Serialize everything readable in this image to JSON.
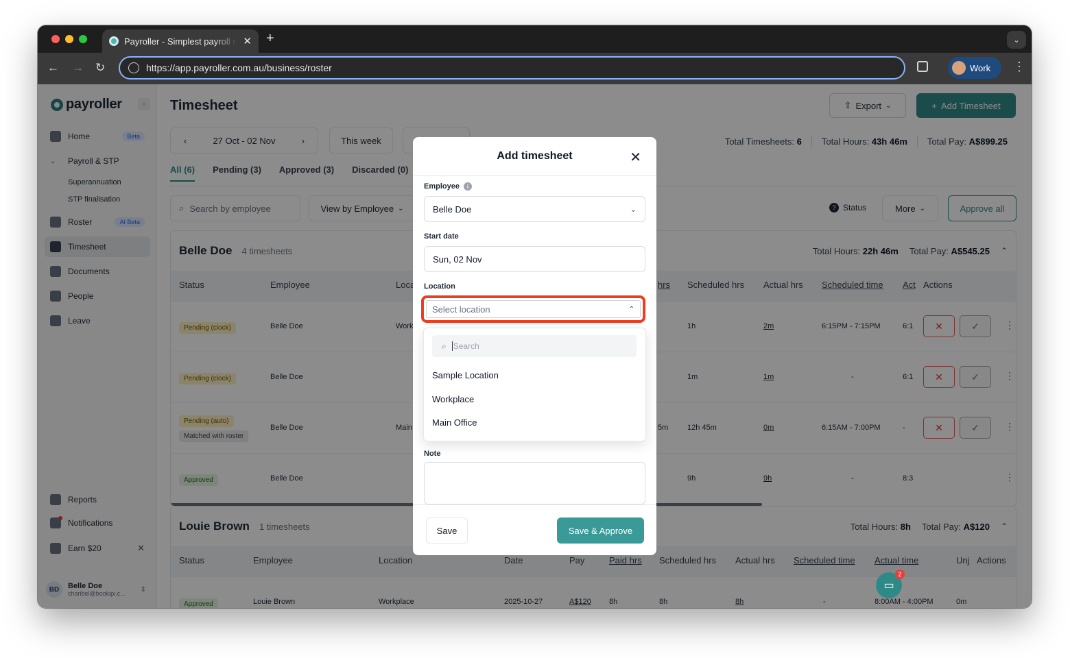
{
  "browser": {
    "tab_title": "Payroller - Simplest payroll software",
    "url": "https://app.payroller.com.au/business/roster",
    "profile_label": "Work"
  },
  "sidebar": {
    "logo": "payroller",
    "items": [
      {
        "label": "Home",
        "badge": "Beta"
      },
      {
        "label": "Payroll & STP"
      },
      {
        "label": "Superannuation"
      },
      {
        "label": "STP finalisation"
      },
      {
        "label": "Roster",
        "badge": "AI Beta"
      },
      {
        "label": "Timesheet"
      },
      {
        "label": "Documents"
      },
      {
        "label": "People"
      },
      {
        "label": "Leave"
      },
      {
        "label": "Reports"
      },
      {
        "label": "Notifications"
      },
      {
        "label": "Earn $20"
      }
    ],
    "user": {
      "initials": "BD",
      "name": "Belle Doe",
      "email": "charibel@bookipi.c..."
    }
  },
  "main": {
    "title": "Timesheet",
    "export_label": "Export",
    "add_label": "Add Timesheet",
    "date_range": "27 Oct - 02 Nov",
    "this_week": "This week",
    "totals": {
      "timesheets_label": "Total Timesheets:",
      "timesheets": "6",
      "hours_label": "Total Hours:",
      "hours": "43h 46m",
      "pay_label": "Total Pay:",
      "pay": "A$899.25"
    },
    "tabs": [
      "All (6)",
      "Pending (3)",
      "Approved (3)",
      "Discarded (0)"
    ],
    "search_placeholder": "Search by employee",
    "view_by": "View by Employee",
    "status_label": "Status",
    "more_label": "More",
    "approve_all": "Approve all"
  },
  "group1": {
    "name": "Belle Doe",
    "count": "4 timesheets",
    "hours_label": "Total Hours:",
    "hours": "22h 46m",
    "pay_label": "Total Pay:",
    "pay": "A$545.25",
    "headers": [
      "Status",
      "Employee",
      "Loca",
      "hrs",
      "Scheduled hrs",
      "Actual hrs",
      "Scheduled time",
      "Act",
      "Actions"
    ],
    "rows": [
      {
        "status": "Pending (clock)",
        "employee": "Belle Doe",
        "location": "Work",
        "scheduled": "1h",
        "actual": "2m",
        "time": "6:15PM - 7:15PM",
        "act": "6:1"
      },
      {
        "status": "Pending (clock)",
        "employee": "Belle Doe",
        "location": "",
        "scheduled": "1m",
        "actual": "1m",
        "time": "-",
        "act": "6:1"
      },
      {
        "status": "Pending (auto)",
        "status2": "Matched with roster",
        "employee": "Belle Doe",
        "location": "Main",
        "paid": "5m",
        "scheduled": "12h 45m",
        "actual": "0m",
        "time": "6:15AM - 7:00PM",
        "act": "-"
      },
      {
        "status": "Approved",
        "employee": "Belle Doe",
        "location": "",
        "scheduled": "9h",
        "actual": "9h",
        "time": "-",
        "act": "8:3"
      }
    ]
  },
  "group2": {
    "name": "Louie Brown",
    "count": "1 timesheets",
    "hours_label": "Total Hours:",
    "hours": "8h",
    "pay_label": "Total Pay:",
    "pay": "A$120",
    "headers": [
      "Status",
      "Employee",
      "Location",
      "Date",
      "Pay",
      "Paid hrs",
      "Scheduled hrs",
      "Actual hrs",
      "Scheduled time",
      "Actual time",
      "Unj",
      "Actions"
    ],
    "row": {
      "status": "Approved",
      "employee": "Louie Brown",
      "location": "Workplace",
      "date": "2025-10-27",
      "pay": "A$120",
      "paid": "8h",
      "scheduled": "8h",
      "actual": "8h",
      "stime": "-",
      "atime": "8:00AM - 4:00PM",
      "unj": "0m"
    }
  },
  "chat_badge": "2",
  "modal": {
    "title": "Add timesheet",
    "employee_label": "Employee",
    "employee_value": "Belle Doe",
    "start_label": "Start date",
    "start_value": "Sun, 02 Nov",
    "location_label": "Location",
    "location_placeholder": "Select location",
    "search_placeholder": "Search",
    "options": [
      "Sample Location",
      "Workplace",
      "Main Office"
    ],
    "note_label": "Note",
    "save_label": "Save",
    "save_approve_label": "Save & Approve"
  }
}
